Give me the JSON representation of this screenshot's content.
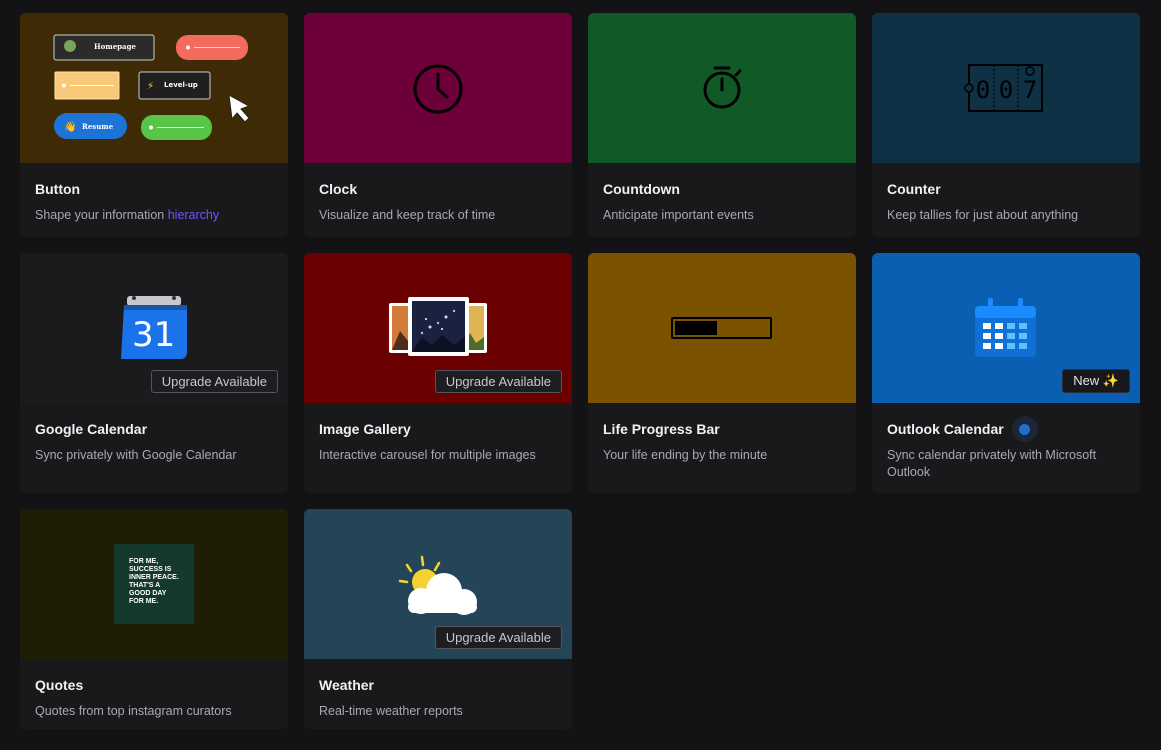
{
  "widgets": [
    {
      "title": "Button",
      "desc_pre": "Shape your information ",
      "desc_hl": "hierarchy",
      "thumb": "#3e2a05",
      "mini": {
        "home": "Homepage",
        "level": "Level-up",
        "resume": "Resume"
      }
    },
    {
      "title": "Clock",
      "desc": "Visualize and keep track of time",
      "thumb": "#6e0039"
    },
    {
      "title": "Countdown",
      "desc": "Anticipate important events",
      "thumb": "#115a27"
    },
    {
      "title": "Counter",
      "desc": "Keep tallies for just about anything",
      "thumb": "#0f3146",
      "digits": [
        "0",
        "0",
        "7"
      ]
    },
    {
      "title": "Google Calendar",
      "desc": "Sync privately with Google Calendar",
      "thumb": "#1b1b1e",
      "badge": "Upgrade Available",
      "cal_day": "31"
    },
    {
      "title": "Image Gallery",
      "desc": "Interactive carousel for multiple images",
      "thumb": "#6a0000",
      "badge": "Upgrade Available"
    },
    {
      "title": "Life Progress Bar",
      "desc": "Your life ending by the minute",
      "thumb": "#7a5200",
      "progress": 0.45
    },
    {
      "title": "Outlook Calendar",
      "desc": "Sync calendar privately with Microsoft Outlook",
      "thumb": "#0a5fb3",
      "badge": "New ✨"
    },
    {
      "title": "Quotes",
      "desc": "Quotes from top instagram curators",
      "thumb": "#1f1e05",
      "quote": [
        "FOR ME,",
        "SUCCESS IS",
        "INNER PEACE.",
        "THAT'S A",
        "GOOD DAY",
        "FOR ME."
      ]
    },
    {
      "title": "Weather",
      "desc": "Real-time weather reports",
      "thumb": "#244557",
      "badge": "Upgrade Available"
    }
  ],
  "colors": {
    "accent": "#6e55ff",
    "background": "#131316",
    "card": "#19191c"
  }
}
